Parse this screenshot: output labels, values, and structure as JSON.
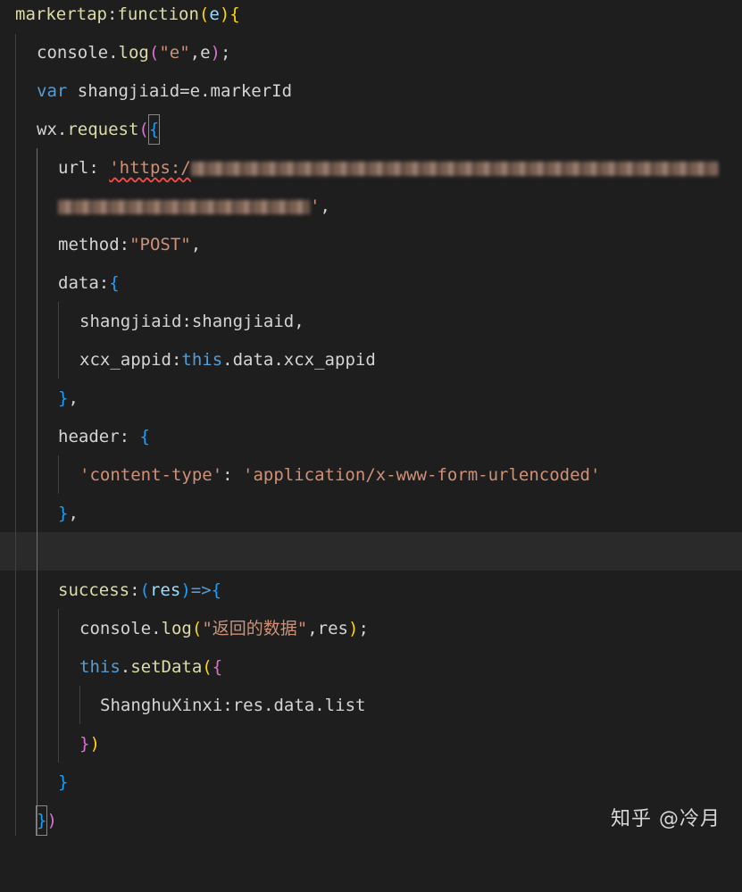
{
  "code": {
    "l1_name": "markertap",
    "l1_colon": ":",
    "l1_kw": "function",
    "l1_paren_open": "(",
    "l1_param": "e",
    "l1_paren_close": ")",
    "l1_brace": "{",
    "l2_obj": "console",
    "l2_dot": ".",
    "l2_fn": "log",
    "l2_po": "(",
    "l2_str": "\"e\"",
    "l2_comma": ",",
    "l2_arg": "e",
    "l2_pc": ")",
    "l2_semi": ";",
    "l3_kw": "var",
    "l3_name": " shangjiaid",
    "l3_eq": "=",
    "l3_rest": "e.markerId",
    "l4_obj": "wx",
    "l4_dot": ".",
    "l4_fn": "request",
    "l4_po": "(",
    "l4_brace": "{",
    "l5_key": "url",
    "l5_colon": ": ",
    "l5_str": "'https:/",
    "l6_end": "'",
    "l6_comma": ",",
    "l7_key": "method",
    "l7_colon": ":",
    "l7_str": "\"POST\"",
    "l7_comma": ",",
    "l8_key": "data",
    "l8_colon": ":",
    "l8_brace": "{",
    "l9_key": "shangjiaid",
    "l9_colon": ":",
    "l9_val": "shangjiaid",
    "l9_comma": ",",
    "l10_key": "xcx_appid",
    "l10_colon": ":",
    "l10_this": "this",
    "l10_rest": ".data.xcx_appid",
    "l11_brace": "}",
    "l11_comma": ",",
    "l12_key": "header",
    "l12_colon": ": ",
    "l12_brace": "{",
    "l13_key": "'content-type'",
    "l13_colon": ": ",
    "l13_val": "'application/x-www-form-urlencoded'",
    "l14_brace": "}",
    "l14_comma": ",",
    "l16_key": "success",
    "l16_colon": ":",
    "l16_po": "(",
    "l16_param": "res",
    "l16_pc": ")",
    "l16_arrow": "=>",
    "l16_brace": "{",
    "l17_obj": "console",
    "l17_dot": ".",
    "l17_fn": "log",
    "l17_po": "(",
    "l17_str": "\"返回的数据\"",
    "l17_comma": ",",
    "l17_arg": "res",
    "l17_pc": ")",
    "l17_semi": ";",
    "l18_this": "this",
    "l18_dot": ".",
    "l18_fn": "setData",
    "l18_po": "(",
    "l18_brace": "{",
    "l19_key": "ShanghuXinxi",
    "l19_colon": ":",
    "l19_rest": "res.data.list",
    "l20_brace": "}",
    "l20_pc": ")",
    "l21_brace": "}",
    "l22_brace": "}",
    "l22_pc": ")"
  },
  "watermark": "知乎 @冷月",
  "colors": {
    "background": "#1e1e1e",
    "keyword": "#569cd6",
    "string": "#ce9178",
    "function": "#dcdcaa",
    "variable": "#9cdcfe"
  }
}
